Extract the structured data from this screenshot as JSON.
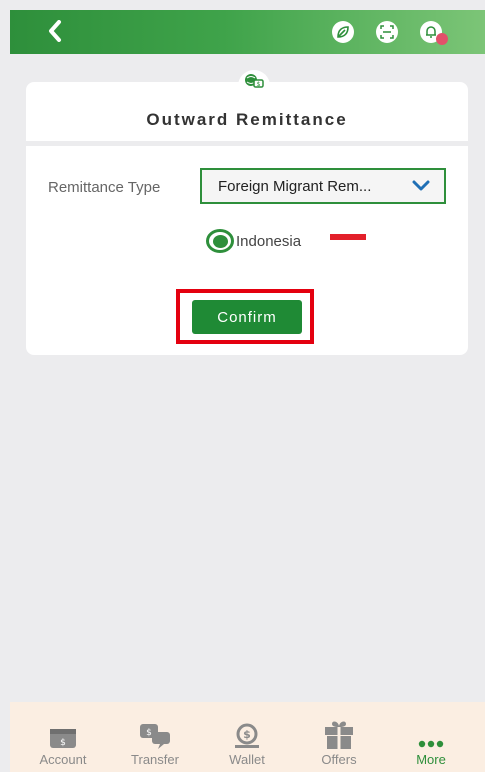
{
  "header": {
    "icons": [
      "back-icon",
      "leaf-icon",
      "scan-icon",
      "bell-icon"
    ]
  },
  "card": {
    "title": "Outward Remittance",
    "remittance_type_label": "Remittance Type",
    "remittance_type_value": "Foreign Migrant Rem...",
    "country_option": "Indonesia",
    "confirm_label": "Confirm"
  },
  "tabbar": {
    "items": [
      {
        "label": "Account",
        "icon": "account-icon"
      },
      {
        "label": "Transfer",
        "icon": "transfer-icon"
      },
      {
        "label": "Wallet",
        "icon": "wallet-icon"
      },
      {
        "label": "Offers",
        "icon": "gift-icon"
      },
      {
        "label": "More",
        "icon": "more-icon"
      }
    ]
  },
  "colors": {
    "brand_green": "#2e8f3b",
    "highlight_red": "#e4000f",
    "tabbar_bg": "#fbeee2"
  }
}
